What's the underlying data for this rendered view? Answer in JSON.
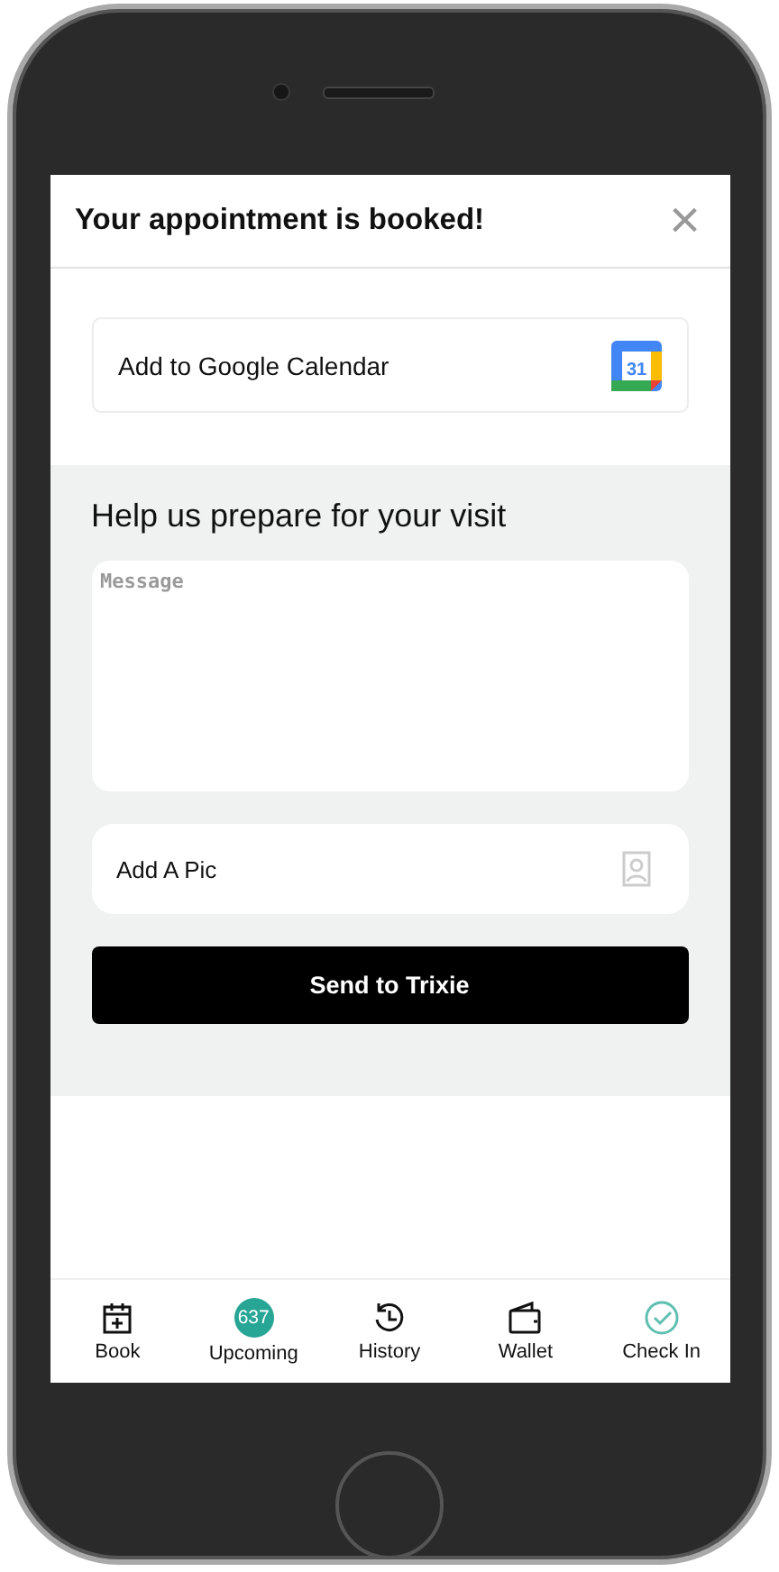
{
  "header": {
    "title": "Your appointment is booked!",
    "close": "×"
  },
  "calendar": {
    "label": "Add to Google Calendar",
    "icon_text": "31"
  },
  "prepare": {
    "heading": "Help us prepare for your visit",
    "message": {
      "placeholder": "Message"
    },
    "pic": {
      "label": "Add A Pic"
    },
    "send": "Send to Trixie"
  },
  "tabs": [
    {
      "label": "Book",
      "kind": "book"
    },
    {
      "label": "Upcoming",
      "kind": "badge",
      "badge": "637"
    },
    {
      "label": "History",
      "kind": "history"
    },
    {
      "label": "Wallet",
      "kind": "wallet"
    },
    {
      "label": "Check In",
      "kind": "check"
    }
  ]
}
